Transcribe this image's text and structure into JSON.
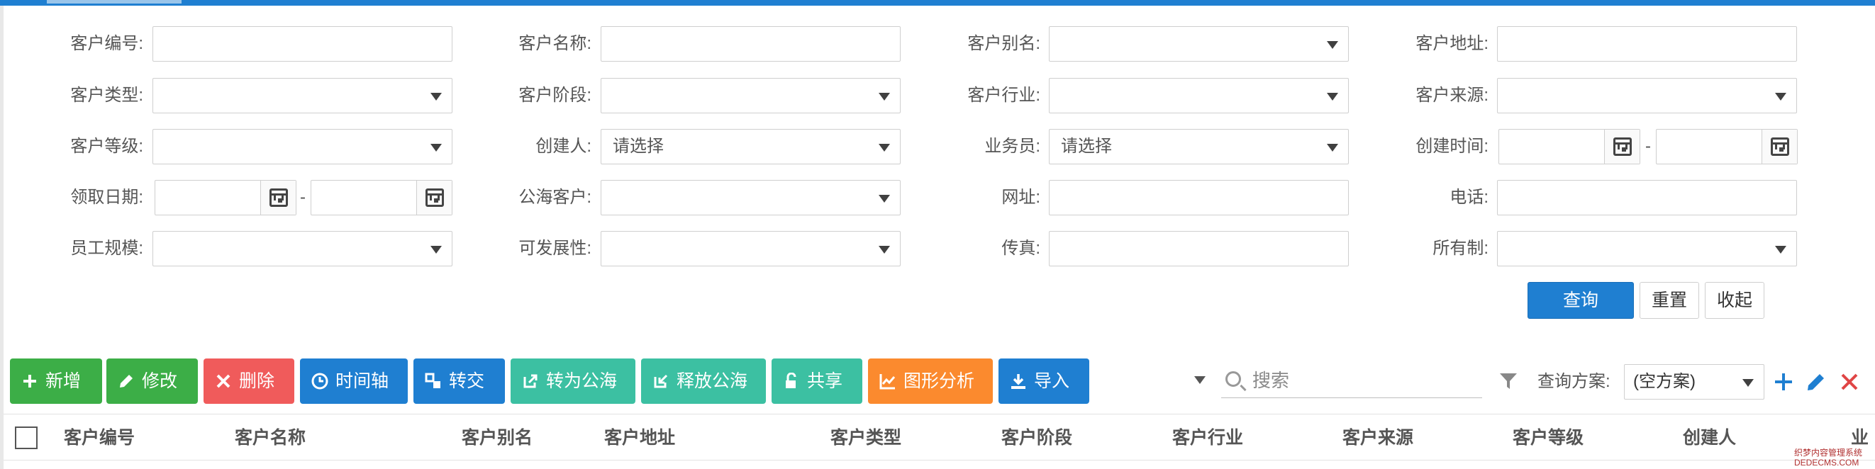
{
  "filters": {
    "customer_no": {
      "label": "客户编号:",
      "value": ""
    },
    "customer_name": {
      "label": "客户名称:",
      "value": ""
    },
    "customer_alias": {
      "label": "客户别名:",
      "value": ""
    },
    "customer_address": {
      "label": "客户地址:",
      "value": ""
    },
    "customer_type": {
      "label": "客户类型:",
      "value": ""
    },
    "customer_stage": {
      "label": "客户阶段:",
      "value": ""
    },
    "customer_industry": {
      "label": "客户行业:",
      "value": ""
    },
    "customer_source": {
      "label": "客户来源:",
      "value": ""
    },
    "customer_level": {
      "label": "客户等级:",
      "value": ""
    },
    "creator": {
      "label": "创建人:",
      "value": "请选择"
    },
    "salesman": {
      "label": "业务员:",
      "value": "请选择"
    },
    "create_time": {
      "label": "创建时间:",
      "separator": "-"
    },
    "claim_date": {
      "label": "领取日期:",
      "separator": "-"
    },
    "public_sea": {
      "label": "公海客户:",
      "value": ""
    },
    "website": {
      "label": "网址:",
      "value": ""
    },
    "phone": {
      "label": "电话:",
      "value": ""
    },
    "staff_size": {
      "label": "员工规模:",
      "value": ""
    },
    "developable": {
      "label": "可发展性:",
      "value": ""
    },
    "fax": {
      "label": "传真:",
      "value": ""
    },
    "ownership": {
      "label": "所有制:",
      "value": ""
    }
  },
  "search_buttons": {
    "query": "查询",
    "reset": "重置",
    "collapse": "收起"
  },
  "toolbar": {
    "add": "新增",
    "edit": "修改",
    "delete": "删除",
    "timeline": "时间轴",
    "transfer": "转交",
    "to_public": "转为公海",
    "release_public": "释放公海",
    "share": "共享",
    "chart_analysis": "图形分析",
    "import": "导入"
  },
  "quick_search": {
    "placeholder": "搜索"
  },
  "query_scheme": {
    "label": "查询方案:",
    "selected": "(空方案)"
  },
  "table": {
    "columns": [
      "客户编号",
      "客户名称",
      "客户别名",
      "客户地址",
      "客户类型",
      "客户阶段",
      "客户行业",
      "客户来源",
      "客户等级",
      "创建人",
      "业"
    ]
  },
  "watermark": {
    "line1": "织梦内容管理系统",
    "line2": "DEDECMS.COM"
  },
  "colors": {
    "primary": "#1f7fd1",
    "add": "#3cae47",
    "edit": "#3cae47",
    "delete": "#f05b5b",
    "timeline": "#1f7fd1",
    "transfer": "#1f7fd1",
    "to_public": "#3cc0a2",
    "release_public": "#3cc0a2",
    "share": "#3cc0a2",
    "chart_analysis": "#fb8a2e",
    "import": "#1f7fd1"
  }
}
